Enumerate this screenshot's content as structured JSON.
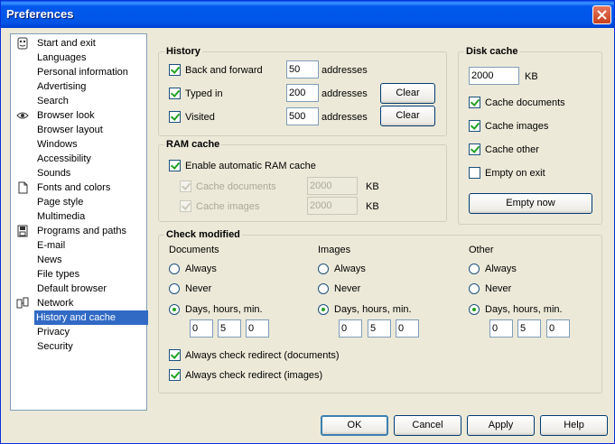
{
  "window": {
    "title": "Preferences"
  },
  "categories": [
    {
      "label": "Start and exit",
      "icon": "ie-icon"
    },
    {
      "label": "Languages"
    },
    {
      "label": "Personal information"
    },
    {
      "label": "Advertising"
    },
    {
      "label": "Search"
    },
    {
      "label": "Browser look",
      "icon": "eye-icon"
    },
    {
      "label": "Browser layout"
    },
    {
      "label": "Windows"
    },
    {
      "label": "Accessibility"
    },
    {
      "label": "Sounds"
    },
    {
      "label": "Fonts and colors",
      "icon": "document-icon"
    },
    {
      "label": "Page style"
    },
    {
      "label": "Multimedia"
    },
    {
      "label": "Programs and paths",
      "icon": "disk-icon"
    },
    {
      "label": "E-mail"
    },
    {
      "label": "News"
    },
    {
      "label": "File types"
    },
    {
      "label": "Default browser"
    },
    {
      "label": "Network",
      "icon": "network-icon"
    },
    {
      "label": "History and cache",
      "selected": true
    },
    {
      "label": "Privacy"
    },
    {
      "label": "Security"
    }
  ],
  "history": {
    "legend": "History",
    "back_forward": {
      "label": "Back and forward",
      "value": "50",
      "unit": "addresses"
    },
    "typed_in": {
      "label": "Typed in",
      "value": "200",
      "unit": "addresses",
      "clear": "Clear"
    },
    "visited": {
      "label": "Visited",
      "value": "500",
      "unit": "addresses",
      "clear": "Clear"
    }
  },
  "disk_cache": {
    "legend": "Disk cache",
    "size": "2000",
    "unit": "KB",
    "cache_documents": "Cache documents",
    "cache_images": "Cache images",
    "cache_other": "Cache other",
    "empty_on_exit": "Empty on exit",
    "empty_now": "Empty now"
  },
  "ram_cache": {
    "legend": "RAM cache",
    "enable_auto": "Enable automatic RAM cache",
    "cache_documents": {
      "label": "Cache documents",
      "value": "2000",
      "unit": "KB"
    },
    "cache_images": {
      "label": "Cache images",
      "value": "2000",
      "unit": "KB"
    }
  },
  "check_modified": {
    "legend": "Check modified",
    "columns": [
      {
        "header": "Documents",
        "always": "Always",
        "never": "Never",
        "days": "Days, hours, min.",
        "d": "0",
        "h": "5",
        "m": "0"
      },
      {
        "header": "Images",
        "always": "Always",
        "never": "Never",
        "days": "Days, hours, min.",
        "d": "0",
        "h": "5",
        "m": "0"
      },
      {
        "header": "Other",
        "always": "Always",
        "never": "Never",
        "days": "Days, hours, min.",
        "d": "0",
        "h": "5",
        "m": "0"
      }
    ],
    "redirect_documents": "Always check redirect (documents)",
    "redirect_images": "Always check redirect (images)"
  },
  "buttons": {
    "ok": "OK",
    "cancel": "Cancel",
    "apply": "Apply",
    "help": "Help"
  }
}
